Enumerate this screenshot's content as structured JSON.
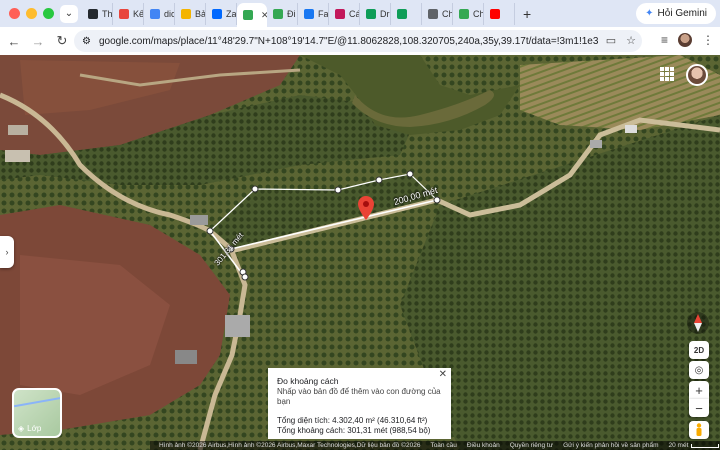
{
  "tabs": [
    {
      "label": "Th",
      "icon": "github-icon",
      "color": "#24292f"
    },
    {
      "label": "Kế",
      "icon": "target-icon",
      "color": "#e8453c"
    },
    {
      "label": "dic",
      "icon": "google-icon",
      "color": "#4285f4"
    },
    {
      "label": "Bả",
      "icon": "slides-icon",
      "color": "#f4b400"
    },
    {
      "label": "Za",
      "icon": "zalo-icon",
      "color": "#0068ff"
    },
    {
      "label": "",
      "icon": "maps-icon",
      "color": "#34a853",
      "active": true
    },
    {
      "label": "Đi",
      "icon": "maps-icon",
      "color": "#34a853"
    },
    {
      "label": "Fa",
      "icon": "facebook-icon",
      "color": "#1877f2"
    },
    {
      "label": "Cá",
      "icon": "calendar-icon",
      "color": "#c2185b"
    },
    {
      "label": "Dr",
      "icon": "drive-icon",
      "color": "#0f9d58"
    },
    {
      "label": "",
      "icon": "sheet-heart-icon",
      "color": "#0f9d58"
    },
    {
      "label": "Ch",
      "icon": "chrome-icon",
      "color": "#5f6368"
    },
    {
      "label": "Ch",
      "icon": "maps-icon",
      "color": "#34a853"
    },
    {
      "label": "",
      "icon": "youtube-icon",
      "color": "#ff0000"
    }
  ],
  "gemini_label": "Hỏi Gemini",
  "url": "google.com/maps/place/11°48'29.7\"N+108°19'14.7\"E/@11.8062828,108.320705,240a,35y,39.17t/data=!3m1!1e3!4m4!...",
  "map": {
    "segment_labels": [
      "200,00 mét",
      "301,31 mét"
    ],
    "layers_label": "Lớp",
    "zoom_in": "+",
    "zoom_out": "−",
    "tilt_label": "2D"
  },
  "measure": {
    "title": "Đo khoảng cách",
    "hint": "Nhấp vào bản đồ để thêm vào con đường của bạn",
    "area": "Tổng diện tích: 4.302,40 m² (46.310,64 ft²)",
    "distance": "Tổng khoảng cách: 301,31 mét (988,54 bộ)"
  },
  "footer": {
    "attribution": "Hình ảnh ©2026 Airbus,Hình ảnh ©2026 Airbus,Maxar Technologies,Dữ liệu bản đồ ©2026",
    "links": [
      "Toàn cầu",
      "Điều khoản",
      "Quyền riêng tư",
      "Gửi ý kiến phản hồi về sản phẩm"
    ],
    "scale": "20 mét"
  }
}
